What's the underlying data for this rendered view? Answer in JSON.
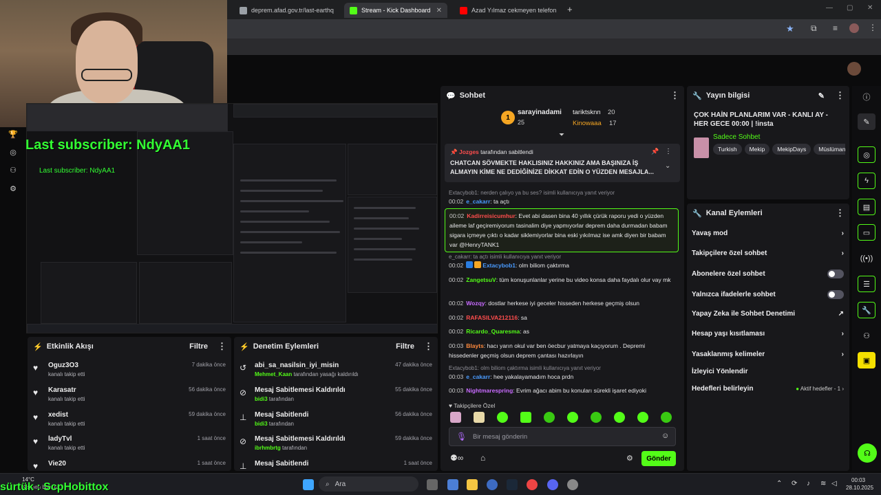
{
  "browser": {
    "tabs": [
      {
        "label": "deprem.afad.gov.tr/last-earthq",
        "icon": "globe-icon"
      },
      {
        "label": "Stream - Kick Dashboard",
        "icon": "kick-icon"
      },
      {
        "label": "Azad Yılmaz cekmeyen telefon",
        "icon": "youtube-icon"
      }
    ]
  },
  "overlay": {
    "last_subscriber": "Last subscriber: NdyAA1",
    "last_subscriber_small": "Last subscriber: NdyAA1",
    "bottom_name": "sürtük : ScpHobittox"
  },
  "activity": {
    "title": "Etkinlik Akışı",
    "filter": "Filtre",
    "items": [
      {
        "name": "Oguz3O3",
        "action": "kanalı takip etti",
        "time": "7 dakika önce"
      },
      {
        "name": "Karasatr",
        "action": "kanalı takip etti",
        "time": "56 dakika önce"
      },
      {
        "name": "xedist",
        "action": "kanalı takip etti",
        "time": "59 dakika önce"
      },
      {
        "name": "ladyTvl",
        "action": "kanalı takip etti",
        "time": "1 saat önce"
      },
      {
        "name": "Vie20",
        "action": "",
        "time": "1 saat önce"
      }
    ]
  },
  "moderation": {
    "title": "Denetim Eylemleri",
    "filter": "Filtre",
    "items": [
      {
        "title": "abi_sa_nasilsin_iyi_misin",
        "user": "Mehmet_Kaan",
        "rest": "tarafından yasağı kaldırıldı",
        "time": "47 dakika önce",
        "icon": "undo-icon"
      },
      {
        "title": "Mesaj Sabitlemesi Kaldırıldı",
        "user": "bidi3",
        "rest": "tarafından",
        "time": "55 dakika önce",
        "icon": "unpin-icon"
      },
      {
        "title": "Mesaj Sabitlendi",
        "user": "bidi3",
        "rest": "tarafından",
        "time": "56 dakika önce",
        "icon": "pin-icon"
      },
      {
        "title": "Mesaj Sabitlemesi Kaldırıldı",
        "user": "ibrhmbrtg",
        "rest": "tarafından",
        "time": "59 dakika önce",
        "icon": "unpin-icon"
      },
      {
        "title": "Mesaj Sabitlendi",
        "user": "",
        "rest": "",
        "time": "1 saat önce",
        "icon": "pin-icon"
      }
    ]
  },
  "chat": {
    "title": "Sohbet",
    "leaderboard": [
      {
        "rank": "1",
        "name": "sarayinadami",
        "count": "25"
      },
      {
        "rank": "",
        "name": "tariktsknn",
        "count": "20"
      },
      {
        "rank": "",
        "name": "Kinowaaa",
        "count": "17"
      }
    ],
    "pinned": {
      "by_user": "Jozges",
      "by_text": "tarafından sabitlendi",
      "text": "CHATCAN SÖVMEKTE HAKLISINIZ HAKKINIZ AMA BAŞINIZA İŞ ALMAYIN KİME NE DEDİĞİNİZE DİKKAT EDİN O YÜZDEN MESAJLA..."
    },
    "messages": [
      {
        "reply": "Extacybob1: nerden çalıyo ya bu ses? isimli kullanıcıya yanıt veriyor"
      },
      {
        "ts": "00:02",
        "user": "e_cakarr",
        "text": "ta açtı",
        "color": "#4a9bff"
      },
      {
        "ts": "00:02",
        "user": "Kadirreisicumhur",
        "text": "Evet abi dasen bina 40 yıllık çürük raporu yedi o yüzden aileme laf geçiremiyorum tasinalim diye yapmıyorlar deprem daha durmadan babam sigara içmeye çıktı o kadar siklemiyorlar bina eski yıkılmaz ise amk diyen bir babam var @HenryTANK1",
        "color": "#ff4d4d"
      },
      {
        "reply": "e_cakarr: ta açtı isimli kullanıcıya yanıt veriyor"
      },
      {
        "ts": "00:02",
        "user": "Extacybob1",
        "text": "olm biliom çaktırma",
        "color": "#4a9bff"
      },
      {
        "ts": "00:02",
        "user": "ZangetsuV",
        "text": "tüm konuşunlanlar yerine bu video konsa daha faydalı olur vay mk",
        "color": "#53fc18"
      },
      {
        "ts": "00:02",
        "user": "Wozqy",
        "text": "dostlar herkese iyi geceler hisseden herkese geçmiş olsun",
        "color": "#c86bff"
      },
      {
        "ts": "00:02",
        "user": "RAFASILVA212116",
        "text": "sa",
        "color": "#ff4d4d"
      },
      {
        "ts": "00:02",
        "user": "Ricardo_Quaresma",
        "text": "as",
        "color": "#53fc18"
      },
      {
        "ts": "00:03",
        "user": "Blayts",
        "text": "hacı yarın okul var ben öecbur yatmaya kaçıyorum . Depremi hissedenler geçmiş olsun deprem çantası hazırlayın",
        "color": "#ff8a3d"
      },
      {
        "reply": "Extacybob1: olm biliom çaktırma isimli kullanıcıya yanıt veriyor"
      },
      {
        "ts": "00:03",
        "user": "e_cakarr",
        "text": "hee yakalayamadım hoca prdn",
        "color": "#4a9bff"
      },
      {
        "ts": "00:03",
        "user": "Nightmarespring",
        "text": "Evrim ağacı abim bu konuları sürekli işaret ediyoki",
        "color": "#c86bff"
      }
    ],
    "emote_label": "Takipçilere Özel",
    "input_placeholder": "Bir mesaj gönderin",
    "send": "Gönder"
  },
  "stream_info": {
    "title": "Yayın bilgisi",
    "stream_title": "ÇOK HAİN PLANLARIM VAR - KANLI AY - HER GECE 00:00 | !insta",
    "category": "Sadece Sohbet",
    "tags": [
      "Turkish",
      "Mekip",
      "MekipDays",
      "Müslüman"
    ]
  },
  "channel_actions": {
    "title": "Kanal Eylemleri",
    "items": [
      {
        "label": "Yavaş mod",
        "control": "chevron"
      },
      {
        "label": "Takipçilere özel sohbet",
        "control": "chevron"
      },
      {
        "label": "Abonelere özel sohbet",
        "control": "toggle"
      },
      {
        "label": "Yalnızca ifadelerle sohbet",
        "control": "toggle"
      },
      {
        "label": "Yapay Zeka ile Sohbet Denetimi",
        "control": "external"
      },
      {
        "label": "Hesap yaşı kısıtlaması",
        "control": "chevron"
      },
      {
        "label": "Yasaklanmış kelimeler",
        "control": "chevron"
      },
      {
        "label": "İzleyici Yönlendir",
        "control": "none"
      },
      {
        "label": "Hedefleri belirleyin",
        "control": "chevron"
      }
    ],
    "goals_status": "Aktif hedefler - 1"
  },
  "taskbar": {
    "weather_temp": "14°C",
    "weather_text": "Kısmen bulutlu",
    "search": "Ara",
    "time": "00:03",
    "date": "28.10.2025"
  },
  "colors": {
    "kick_green": "#53fc18",
    "panel": "#18181b"
  }
}
